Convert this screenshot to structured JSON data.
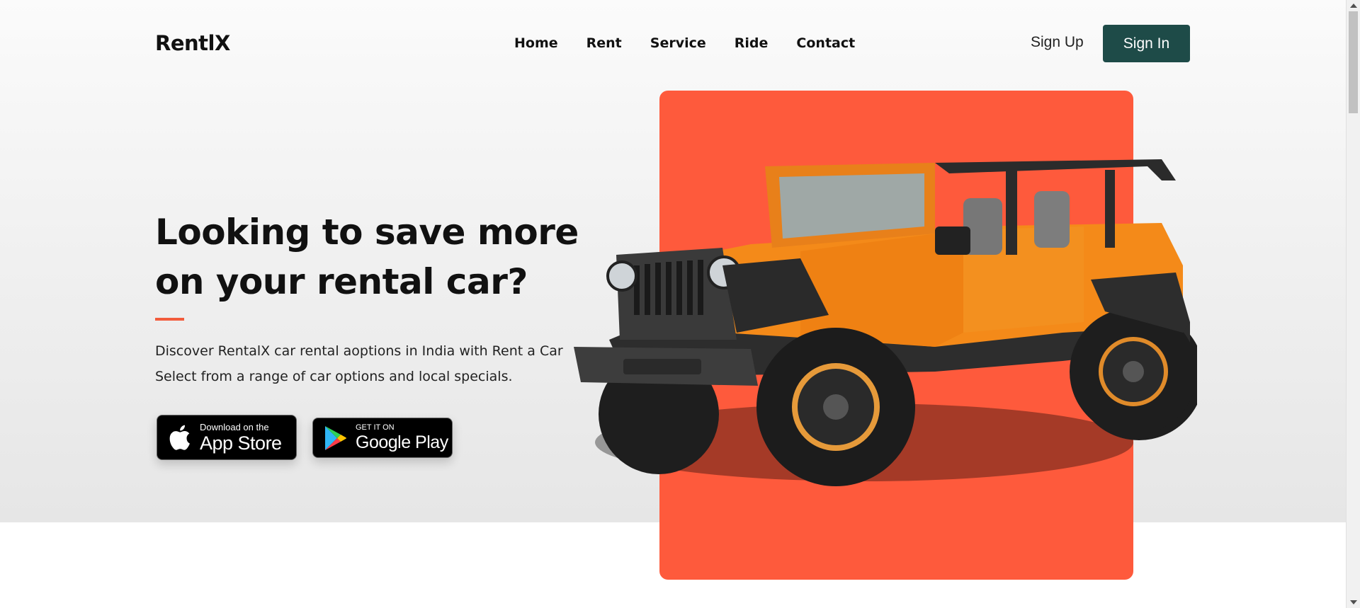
{
  "header": {
    "brand": "RentlX",
    "nav": [
      "Home",
      "Rent",
      "Service",
      "Ride",
      "Contact"
    ],
    "sign_up": "Sign Up",
    "sign_in": "Sign In"
  },
  "hero": {
    "headline_line1": "Looking to save more",
    "headline_line2": "on your rental car?",
    "desc_line1": "Discover RentalX car rental aoptions in India with Rent a Car",
    "desc_line2": "Select from a range of car options and local specials.",
    "app_store": {
      "small": "Download on the",
      "big": "App Store",
      "icon": "apple-icon"
    },
    "google_play": {
      "small": "GET IT ON",
      "big": "Google Play",
      "icon": "google-play-icon"
    },
    "image": "orange-jeep"
  },
  "colors": {
    "accent": "#fe5a3c",
    "sign_in_bg": "#1e4b48",
    "text": "#111111"
  }
}
